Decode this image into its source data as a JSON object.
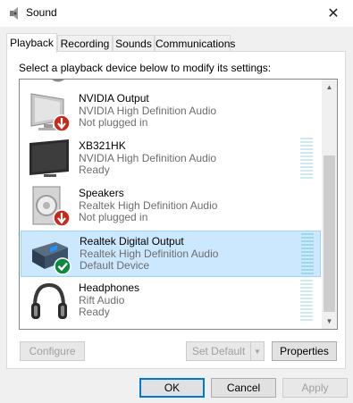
{
  "window": {
    "title": "Sound"
  },
  "tabs": [
    {
      "label": "Playback"
    },
    {
      "label": "Recording"
    },
    {
      "label": "Sounds"
    },
    {
      "label": "Communications"
    }
  ],
  "instructions": "Select a playback device below to modify its settings:",
  "devices": [
    {
      "name": "NVIDIA Output",
      "description": "NVIDIA High Definition Audio",
      "status": "Not plugged in",
      "icon": "monitor-icon",
      "badge": "unplugged"
    },
    {
      "name": "XB321HK",
      "description": "NVIDIA High Definition Audio",
      "status": "Ready",
      "icon": "tv-icon"
    },
    {
      "name": "Speakers",
      "description": "Realtek High Definition Audio",
      "status": "Not plugged in",
      "icon": "speaker-icon",
      "badge": "unplugged"
    },
    {
      "name": "Realtek Digital Output",
      "description": "Realtek High Definition Audio",
      "status": "Default Device",
      "icon": "digital-output-icon",
      "badge": "default",
      "selected": true
    },
    {
      "name": "Headphones",
      "description": "Rift Audio",
      "status": "Ready",
      "icon": "headphones-icon"
    }
  ],
  "buttons": {
    "configure": "Configure",
    "set_default": "Set Default",
    "properties": "Properties",
    "ok": "OK",
    "cancel": "Cancel",
    "apply": "Apply"
  },
  "colors": {
    "selection": "#cce8ff",
    "selection_border": "#99d1ff",
    "accent": "#0078d7"
  }
}
